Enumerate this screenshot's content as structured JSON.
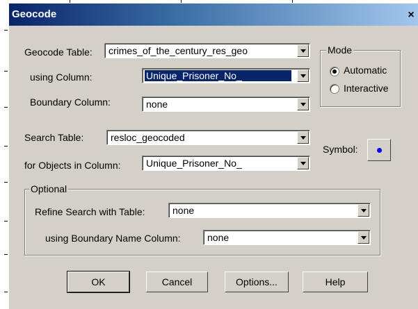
{
  "dialog": {
    "title": "Geocode",
    "close_symbol": "×"
  },
  "geocode_table": {
    "label": "Geocode Table:",
    "value": "crimes_of_the_century_res_geo"
  },
  "using_column": {
    "label": "using Column:",
    "value": "Unique_Prisoner_No_"
  },
  "boundary_column": {
    "label": "Boundary Column:",
    "value": "none"
  },
  "mode": {
    "title": "Mode",
    "options": [
      "Automatic",
      "Interactive"
    ],
    "selected": "Automatic"
  },
  "search_table": {
    "label": "Search Table:",
    "value": "resloc_geocoded"
  },
  "objects_column": {
    "label": "for Objects in Column:",
    "value": "Unique_Prisoner_No_"
  },
  "symbol": {
    "label": "Symbol:",
    "color": "#0000ff"
  },
  "optional": {
    "title": "Optional",
    "refine_label": "Refine Search with Table:",
    "refine_value": "none",
    "boundary_name_label": "using Boundary Name Column:",
    "boundary_name_value": "none"
  },
  "buttons": {
    "ok": "OK",
    "cancel": "Cancel",
    "options": "Options...",
    "help": "Help"
  }
}
